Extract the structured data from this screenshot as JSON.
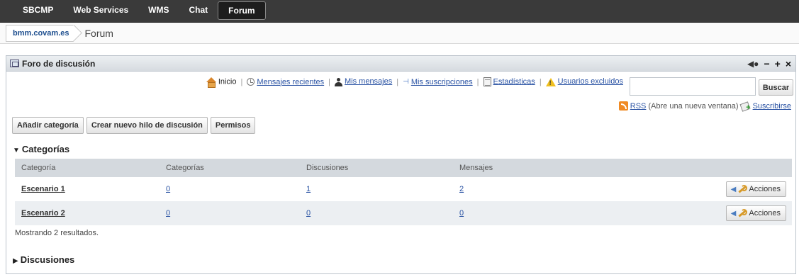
{
  "topnav": {
    "items": [
      {
        "label": "SBCMP",
        "active": false
      },
      {
        "label": "Web Services",
        "active": false
      },
      {
        "label": "WMS",
        "active": false
      },
      {
        "label": "Chat",
        "active": false
      },
      {
        "label": "Forum",
        "active": true
      }
    ]
  },
  "breadcrumb": {
    "site": "bmm.covam.es",
    "page": "Forum"
  },
  "portlet": {
    "title": "Foro de discusión",
    "controls": [
      "−",
      "+",
      "×"
    ]
  },
  "links": {
    "home": "Inicio",
    "recent": "Mensajes recientes",
    "mine": "Mis mensajes",
    "subscriptions": "Mis suscripciones",
    "stats": "Estadísticas",
    "banned": "Usuarios excluidos",
    "separator": "|"
  },
  "search": {
    "value": "",
    "button": "Buscar"
  },
  "rss": {
    "label": "RSS",
    "note": "(Abre una nueva ventana)",
    "subscribe": "Suscribirse"
  },
  "actions": {
    "add_category": "Añadir categoría",
    "new_thread": "Crear nuevo hilo de discusión",
    "permissions": "Permisos"
  },
  "categories_section": {
    "title": "Categorías",
    "columns": [
      "Categoría",
      "Categorías",
      "Discusiones",
      "Mensajes"
    ],
    "rows": [
      {
        "name": "Escenario 1",
        "categories": "0",
        "threads": "1",
        "messages": "2",
        "action": "Acciones"
      },
      {
        "name": "Escenario 2",
        "categories": "0",
        "threads": "0",
        "messages": "0",
        "action": "Acciones"
      }
    ],
    "results": "Mostrando 2 resultados."
  },
  "threads_section": {
    "title": "Discusiones"
  },
  "colors": {
    "nav_bg": "#3a3a3a",
    "link": "#2952a3",
    "header_row": "#d4d9de",
    "alt_row": "#eceff2"
  }
}
